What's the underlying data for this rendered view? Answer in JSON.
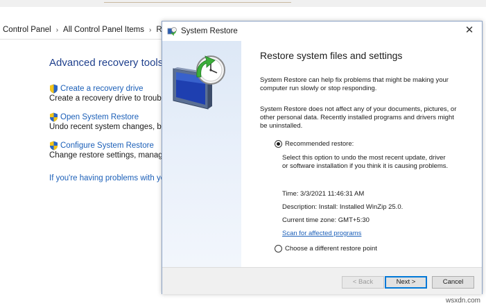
{
  "control_panel": {
    "breadcrumbs": [
      "Control Panel",
      "All Control Panel Items",
      "Reco"
    ],
    "section_title": "Advanced recovery tools",
    "items": [
      {
        "link": "Create a recovery drive",
        "desc": "Create a recovery drive to troublest"
      },
      {
        "link": "Open System Restore",
        "desc": "Undo recent system changes, but le"
      },
      {
        "link": "Configure System Restore",
        "desc": "Change restore settings, manage di"
      }
    ],
    "help_link": "If you're having problems with your"
  },
  "dialog": {
    "title": "System Restore",
    "heading": "Restore system files and settings",
    "intro": "System Restore can help fix problems that might be making your computer run slowly or stop responding.",
    "note": "System Restore does not affect any of your documents, pictures, or other personal data. Recently installed programs and drivers might be uninstalled.",
    "recommended": {
      "label": "Recommended restore:",
      "checked": true,
      "description": "Select this option to undo the most recent update, driver or software installation if you think it is causing problems.",
      "time": "Time: 3/3/2021 11:46:31 AM",
      "description_line": "Description: Install: Installed WinZip 25.0.",
      "timezone": "Current time zone: GMT+5:30",
      "scan_link": "Scan for affected programs"
    },
    "different": {
      "label": "Choose a different restore point",
      "checked": false
    },
    "buttons": {
      "back": "< Back",
      "next": "Next >",
      "cancel": "Cancel"
    }
  },
  "watermark": "wsxdn.com",
  "colors": {
    "link": "#1b5fb8",
    "title_blue": "#1e3f8c",
    "side_panel": "#dde8f6",
    "footer": "#f0f0f0"
  },
  "icons": [
    "shield-icon",
    "system-restore-icon",
    "close-icon"
  ]
}
